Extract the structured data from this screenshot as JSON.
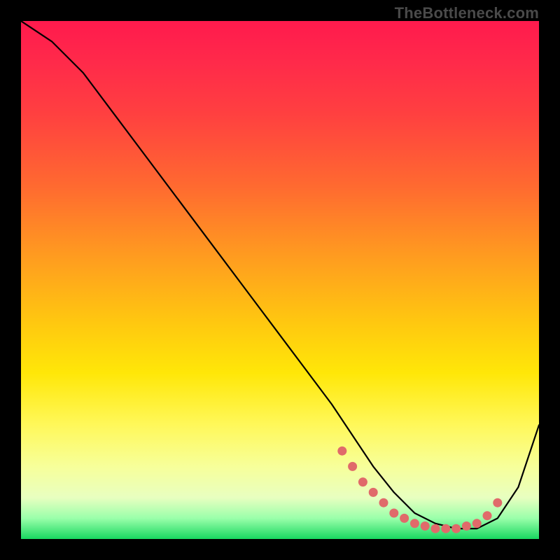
{
  "attribution": "TheBottleneck.com",
  "chart_data": {
    "type": "line",
    "title": "",
    "xlabel": "",
    "ylabel": "",
    "xlim": [
      0,
      100
    ],
    "ylim": [
      0,
      100
    ],
    "grid": false,
    "series": [
      {
        "name": "curve",
        "x": [
          0,
          6,
          12,
          18,
          24,
          30,
          36,
          42,
          48,
          54,
          60,
          64,
          68,
          72,
          76,
          80,
          84,
          88,
          92,
          96,
          100
        ],
        "y": [
          100,
          96,
          90,
          82,
          74,
          66,
          58,
          50,
          42,
          34,
          26,
          20,
          14,
          9,
          5,
          3,
          2,
          2,
          4,
          10,
          22
        ]
      }
    ],
    "markers": {
      "name": "valley-dots",
      "x": [
        62,
        64,
        66,
        68,
        70,
        72,
        74,
        76,
        78,
        80,
        82,
        84,
        86,
        88,
        90,
        92
      ],
      "y": [
        17,
        14,
        11,
        9,
        7,
        5,
        4,
        3,
        2.5,
        2,
        2,
        2,
        2.5,
        3,
        4.5,
        7
      ]
    },
    "gradient_stops": [
      {
        "pos": 0,
        "color": "#ff1a4d"
      },
      {
        "pos": 18,
        "color": "#ff4040"
      },
      {
        "pos": 45,
        "color": "#ff9a20"
      },
      {
        "pos": 68,
        "color": "#ffe708"
      },
      {
        "pos": 92,
        "color": "#e8ffc0"
      },
      {
        "pos": 100,
        "color": "#18d860"
      }
    ]
  }
}
